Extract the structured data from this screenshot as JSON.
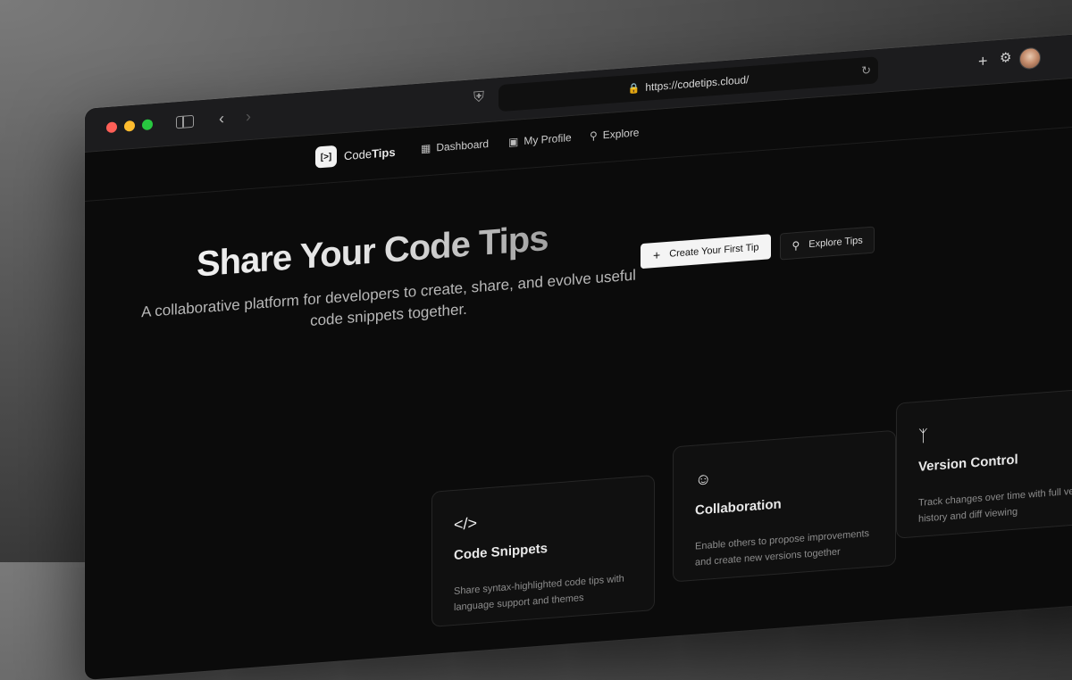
{
  "browser": {
    "url": "https://codetips.cloud/"
  },
  "brand": {
    "logo_glyph": "[>]",
    "name_prefix": "Code",
    "name_bold": "Tips"
  },
  "nav": [
    {
      "label": "Dashboard",
      "icon": "grid-icon"
    },
    {
      "label": "My Profile",
      "icon": "profile-card-icon"
    },
    {
      "label": "Explore",
      "icon": "explore-search-icon"
    }
  ],
  "hero": {
    "title": "Share Your Code Tips",
    "subtitle": "A collaborative platform for developers to create, share, and evolve useful code snippets together.",
    "primary_button": "Create Your First Tip",
    "secondary_button": "Explore Tips"
  },
  "features": [
    {
      "icon": "code-icon",
      "title": "Code Snippets",
      "description": "Share syntax-highlighted code tips with language support and themes"
    },
    {
      "icon": "users-icon",
      "title": "Collaboration",
      "description": "Enable others to propose improvements and create new versions together"
    },
    {
      "icon": "git-branch-icon",
      "title": "Version Control",
      "description": "Track changes over time with full version history and diff viewing"
    }
  ],
  "colors": {
    "background": "#0b0b0b",
    "primary_button_bg": "#f4f4f4",
    "traffic_red": "#ff5f57",
    "traffic_yellow": "#febc2e",
    "traffic_green": "#28c840"
  }
}
